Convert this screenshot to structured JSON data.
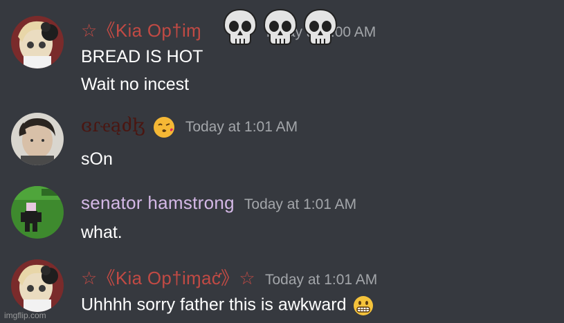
{
  "messages": [
    {
      "username": "☆《Kia Op†iɱ",
      "timestamp": "Today at 1:00 AM",
      "lines": [
        "BREAD IS HOT",
        "Wait no incest"
      ],
      "overlay_emojis": [
        "skull-emoji",
        "skull-emoji",
        "skull-emoji"
      ]
    },
    {
      "username": "ɞɾҽąძɮ",
      "username_emoji": "kissing-face-emoji",
      "timestamp": "Today at 1:01 AM",
      "lines": [
        "sOn"
      ]
    },
    {
      "username": "senator hamstrong",
      "timestamp": "Today at 1:01 AM",
      "lines": [
        "what."
      ]
    },
    {
      "username": "☆《Kia Op†iɱaƈ̇》☆",
      "timestamp": "Today at 1:01 AM",
      "lines": [
        "Uhhhh sorry father this is awkward"
      ],
      "line_emoji": "grimacing-face-emoji"
    }
  ],
  "watermark": "imgflip.com",
  "colors": {
    "background": "#36393f",
    "kia_name": "#c14a44",
    "bread_name": "#4a1611",
    "senator_name": "#d4b8e6",
    "timestamp": "#a3a6aa",
    "text": "#ffffff"
  }
}
